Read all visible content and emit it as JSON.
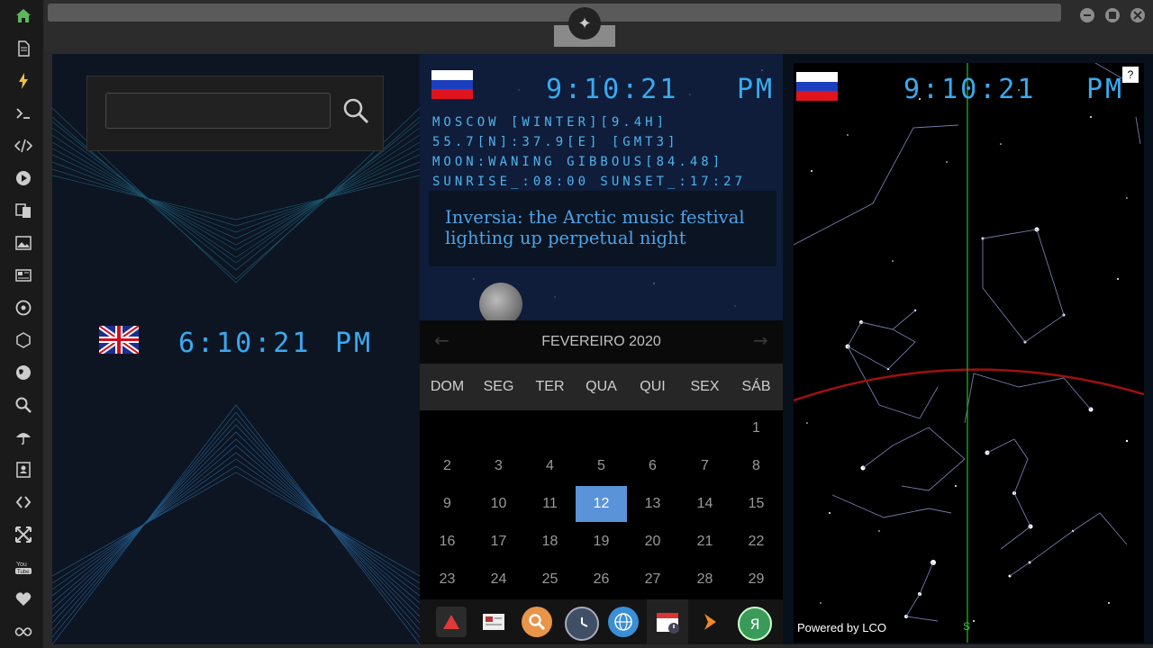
{
  "browser": {
    "tab_logo": "rebel-alliance-logo"
  },
  "sidebar": {
    "icons": [
      "home-icon",
      "document-icon",
      "lightning-icon",
      "terminal-icon",
      "code-icon",
      "play-icon",
      "translate-icon",
      "image-icon",
      "news-icon",
      "settings-icon",
      "cube-icon",
      "globe-icon",
      "search-icon",
      "umbrella-icon",
      "contacts-icon",
      "link-icon",
      "fullscreen-icon",
      "youtube-icon",
      "heart-icon",
      "infinity-icon"
    ]
  },
  "left_clock": {
    "time": "6:10:21",
    "ampm": "PM",
    "flag": "uk-flag"
  },
  "moscow_clock": {
    "time": "9:10:21",
    "ampm": "PM",
    "flag": "russia-flag"
  },
  "moscow_info": {
    "line1": "MOSCOW [WINTER][9.4H]",
    "line2": "55.7[N]:37.9[E] [GMT3]",
    "line3": "MOON:WANING GIBBOUS[84.48]",
    "line4": "SUNRISE_:08:00 SUNSET_:17:27"
  },
  "news_headline": "Inversia: the Arctic music festival lighting up perpetual night",
  "calendar": {
    "title": "FEVEREIRO 2020",
    "weekdays": [
      "DOM",
      "SEG",
      "TER",
      "QUA",
      "QUI",
      "SEX",
      "SÁB"
    ],
    "selected_day": "12",
    "weeks": [
      [
        "",
        "",
        "",
        "",
        "",
        "",
        "1"
      ],
      [
        "2",
        "3",
        "4",
        "5",
        "6",
        "7",
        "8"
      ],
      [
        "9",
        "10",
        "11",
        "12",
        "13",
        "14",
        "15"
      ],
      [
        "16",
        "17",
        "18",
        "19",
        "20",
        "21",
        "22"
      ],
      [
        "23",
        "24",
        "25",
        "26",
        "27",
        "28",
        "29"
      ]
    ]
  },
  "dock": {
    "apps": [
      "vivaldi-icon",
      "news-icon",
      "search-icon",
      "clock-icon",
      "globe-icon",
      "calendar-icon",
      "forward-icon",
      "yandex-icon"
    ],
    "yandex_letter": "Я"
  },
  "sky": {
    "clock_time": "9:10:21",
    "clock_ampm": "PM",
    "help": "?",
    "south_label": "S",
    "powered_by": "Powered by LCO"
  }
}
